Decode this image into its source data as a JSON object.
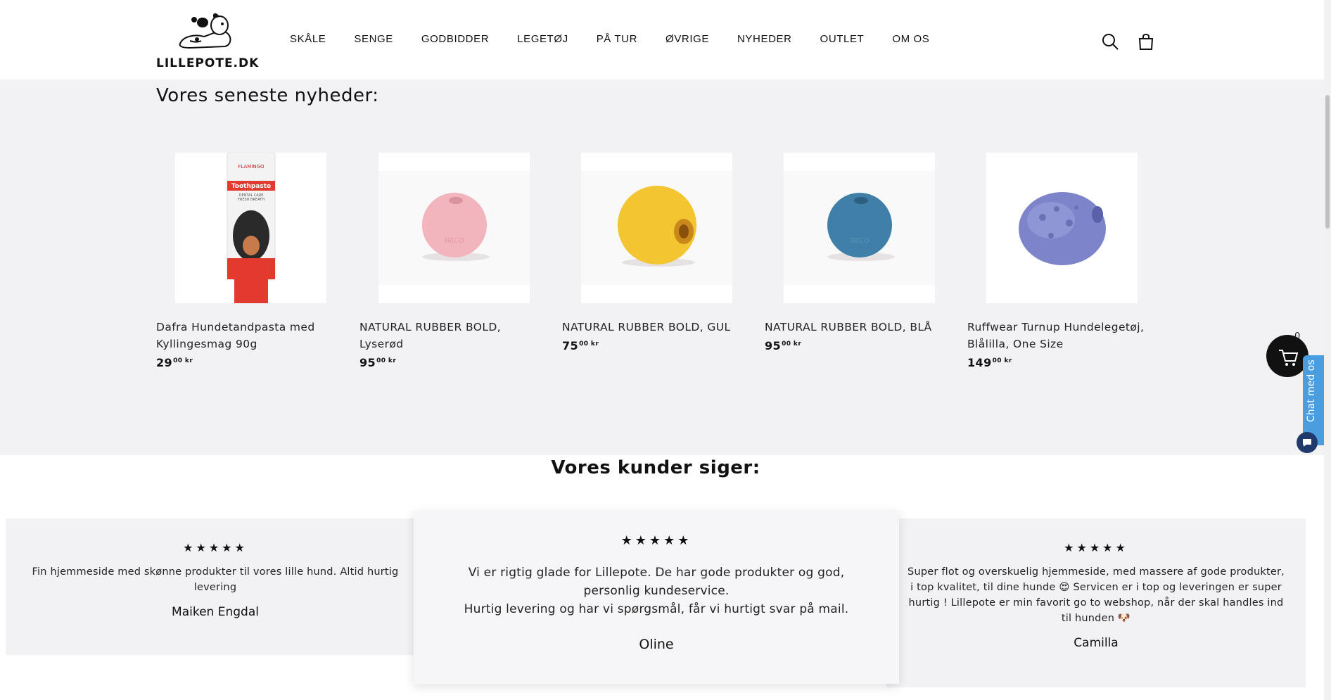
{
  "header": {
    "logo_text": "LILLEPOTE.DK",
    "nav": [
      "SKÅLE",
      "SENGE",
      "GODBIDDER",
      "LEGETØJ",
      "PÅ TUR",
      "ØVRIGE",
      "NYHEDER",
      "OUTLET",
      "OM OS"
    ]
  },
  "news": {
    "title": "Vores seneste nyheder:",
    "products": [
      {
        "name": "Dafra Hundetandpasta med Kyllingesmag 90g",
        "price_main": "29",
        "price_cents": "00 kr",
        "image": "toothpaste-tube",
        "tube_brand": "FLAMINGO",
        "tube_label": "Toothpaste",
        "tube_sub1": "DENTAL CARE",
        "tube_sub2": "FRESH BREATH"
      },
      {
        "name": "NATURAL RUBBER BOLD, Lyserød",
        "price_main": "95",
        "price_cents": "00 kr",
        "image": "ball",
        "color": "#f2b4bd",
        "logo": "BECO"
      },
      {
        "name": "NATURAL RUBBER BOLD, GUL",
        "price_main": "75",
        "price_cents": "00 kr",
        "image": "ball",
        "color": "#f3c531"
      },
      {
        "name": "NATURAL RUBBER BOLD, BLÅ",
        "price_main": "95",
        "price_cents": "00 kr",
        "image": "ball",
        "color": "#3f7fa8",
        "logo": "BECO"
      },
      {
        "name": "Ruffwear Turnup Hundelegetøj, Blålilla, One Size",
        "price_main": "149",
        "price_cents": "00 kr",
        "image": "ball",
        "color": "#7d84c9"
      }
    ]
  },
  "reviews": {
    "title": "Vores kunder siger:",
    "items": [
      {
        "stars": "★★★★★",
        "text": "Fin hjemmeside med skønne produkter til vores lille hund. Altid hurtig levering",
        "name": "Maiken Engdal"
      },
      {
        "stars": "★★★★★",
        "text_lines": [
          "Vi er rigtig glade for Lillepote. De har gode produkter og god,",
          "personlig kundeservice.",
          "Hurtig levering og har vi spørgsmål, får vi hurtigt svar på mail."
        ],
        "name": "Oline"
      },
      {
        "stars": "★★★★★",
        "text": "Super flot og overskuelig hjemmeside, med massere af gode produkter, i top kvalitet, til dine hunde 😍 Servicen er i top og leveringen er super hurtig ! Lillepote er min favorit go to webshop, når der skal handles ind til hunden 🐶",
        "name": "Camilla"
      }
    ]
  },
  "floating": {
    "cart_count": "0",
    "chat_label": "Chat med os"
  }
}
